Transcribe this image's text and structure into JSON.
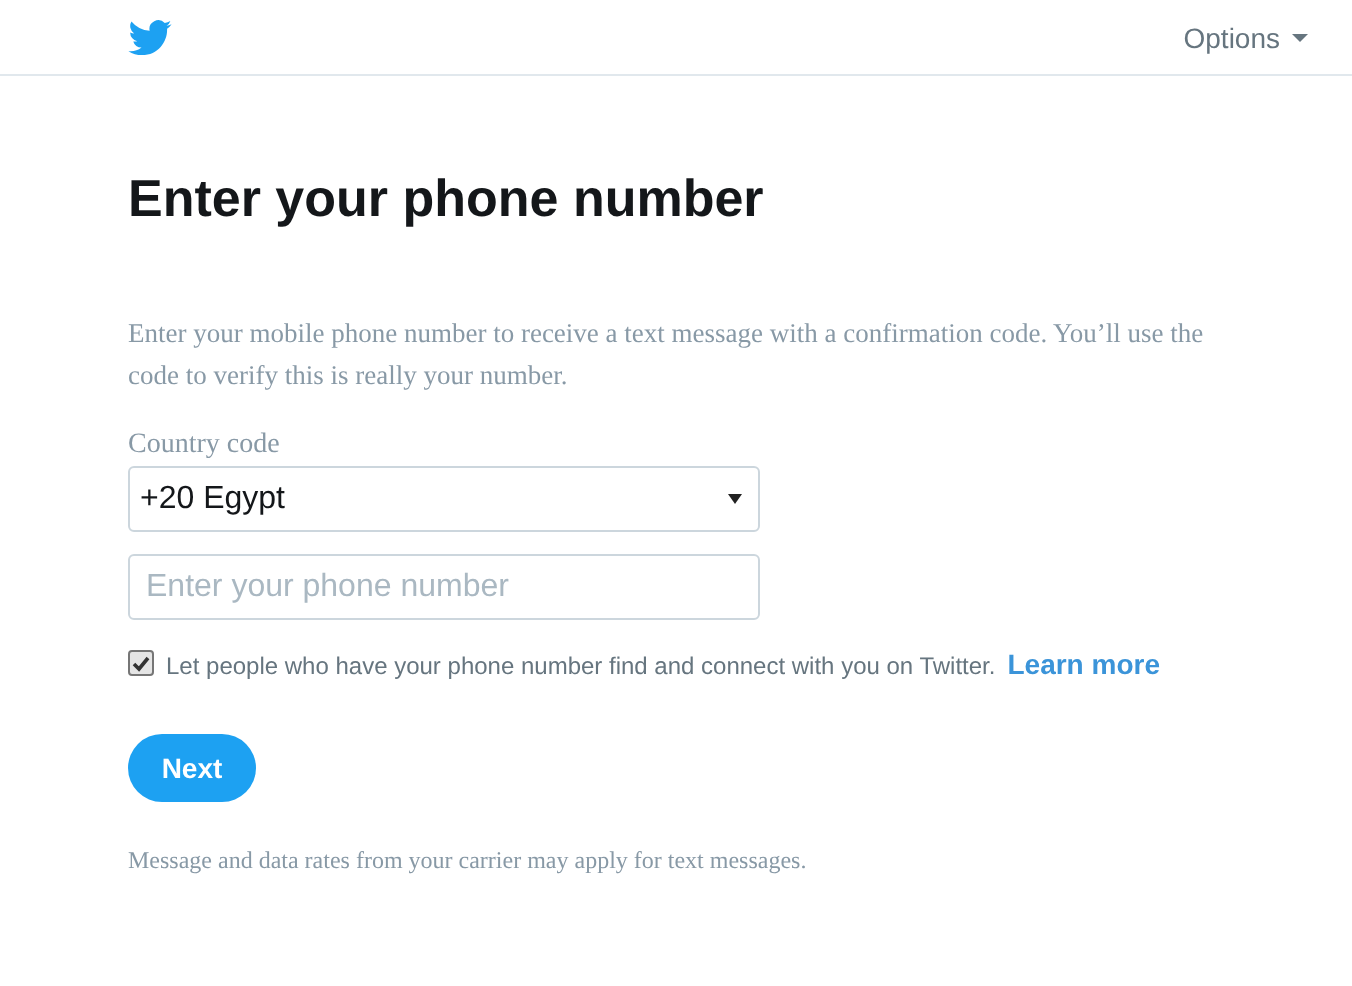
{
  "header": {
    "options_menu": "Options"
  },
  "title": "Enter your phone number",
  "description": "Enter your mobile phone number to receive a text message with a confirmation code. You’ll use the code to verify this is really your number.",
  "country_code": {
    "label": "Country code",
    "value": "+20 Egypt"
  },
  "phone": {
    "placeholder": "Enter your phone number"
  },
  "discoverable": {
    "checked": true,
    "label": "Let people who have your phone number find and connect with you on Twitter.",
    "link": "Learn more"
  },
  "next_button": "Next",
  "footnote": "Message and data rates from your carrier may apply for text messages."
}
